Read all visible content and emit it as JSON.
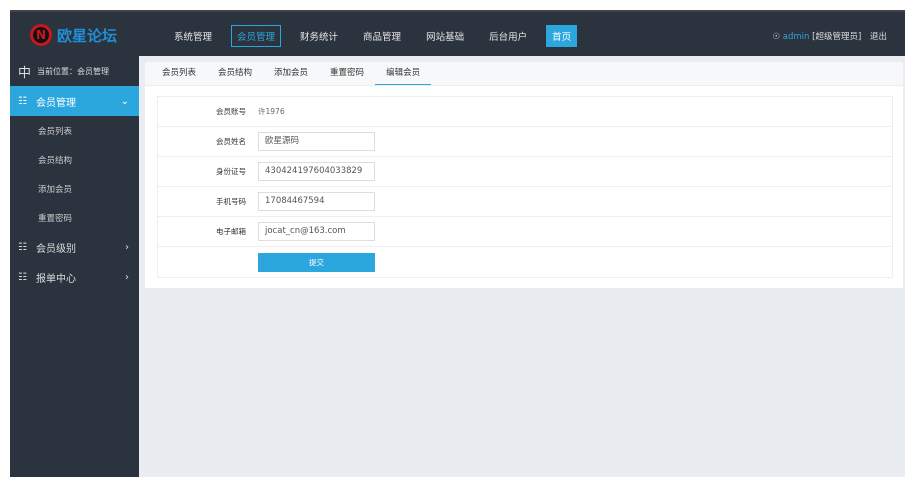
{
  "header": {
    "logo_mark": "N",
    "logo_text": "欧星论坛",
    "nav": [
      {
        "label": "系统管理"
      },
      {
        "label": "会员管理",
        "active": true
      },
      {
        "label": "财务统计"
      },
      {
        "label": "商品管理"
      },
      {
        "label": "网站基础"
      },
      {
        "label": "后台用户"
      },
      {
        "label": "首页",
        "home": true
      }
    ],
    "user_name": "admin",
    "user_role": "[超级管理员]",
    "logout": "退出"
  },
  "sidebar": {
    "location": "当前位置：会员管理",
    "section1": "会员管理",
    "sub": [
      "会员列表",
      "会员结构",
      "添加会员",
      "重置密码"
    ],
    "section2": "会员级别",
    "section3": "报单中心"
  },
  "tabs": [
    "会员列表",
    "会员结构",
    "添加会员",
    "重置密码",
    "编辑会员"
  ],
  "form": {
    "account_label": "会员账号",
    "account_value": "许1976",
    "name_label": "会员姓名",
    "name_value": "欧星源码",
    "id_label": "身份证号",
    "id_value": "430424197604033829",
    "phone_label": "手机号码",
    "phone_value": "17084467594",
    "email_label": "电子邮箱",
    "email_value": "jocat_cn@163.com",
    "submit": "提交"
  },
  "colors": {
    "accent": "#2ba7de",
    "dark": "#2b333e"
  }
}
